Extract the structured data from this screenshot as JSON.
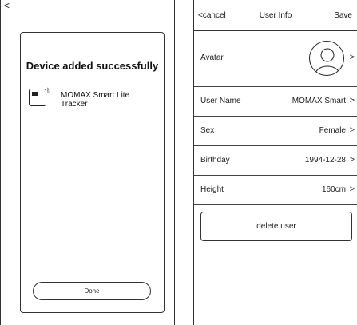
{
  "device_added": {
    "back_icon": "chevron-left-icon",
    "title": "Device added successfully",
    "device": {
      "icon": "tracker-device-icon",
      "bluetooth_icon": "bluetooth-icon",
      "name": "MOMAX Smart Lite Tracker"
    },
    "done_label": "Done"
  },
  "user_info": {
    "nav": {
      "cancel_label": "<cancel",
      "title": "User Info",
      "save_label": "Save"
    },
    "rows": [
      {
        "label": "Avatar",
        "value": ""
      },
      {
        "label": "User Name",
        "value": "MOMAX Smart"
      },
      {
        "label": "Sex",
        "value": "Female"
      },
      {
        "label": "Birthday",
        "value": "1994-12-28"
      },
      {
        "label": "Height",
        "value": "160cm"
      }
    ],
    "chevron": ">",
    "delete_label": "delete user"
  }
}
